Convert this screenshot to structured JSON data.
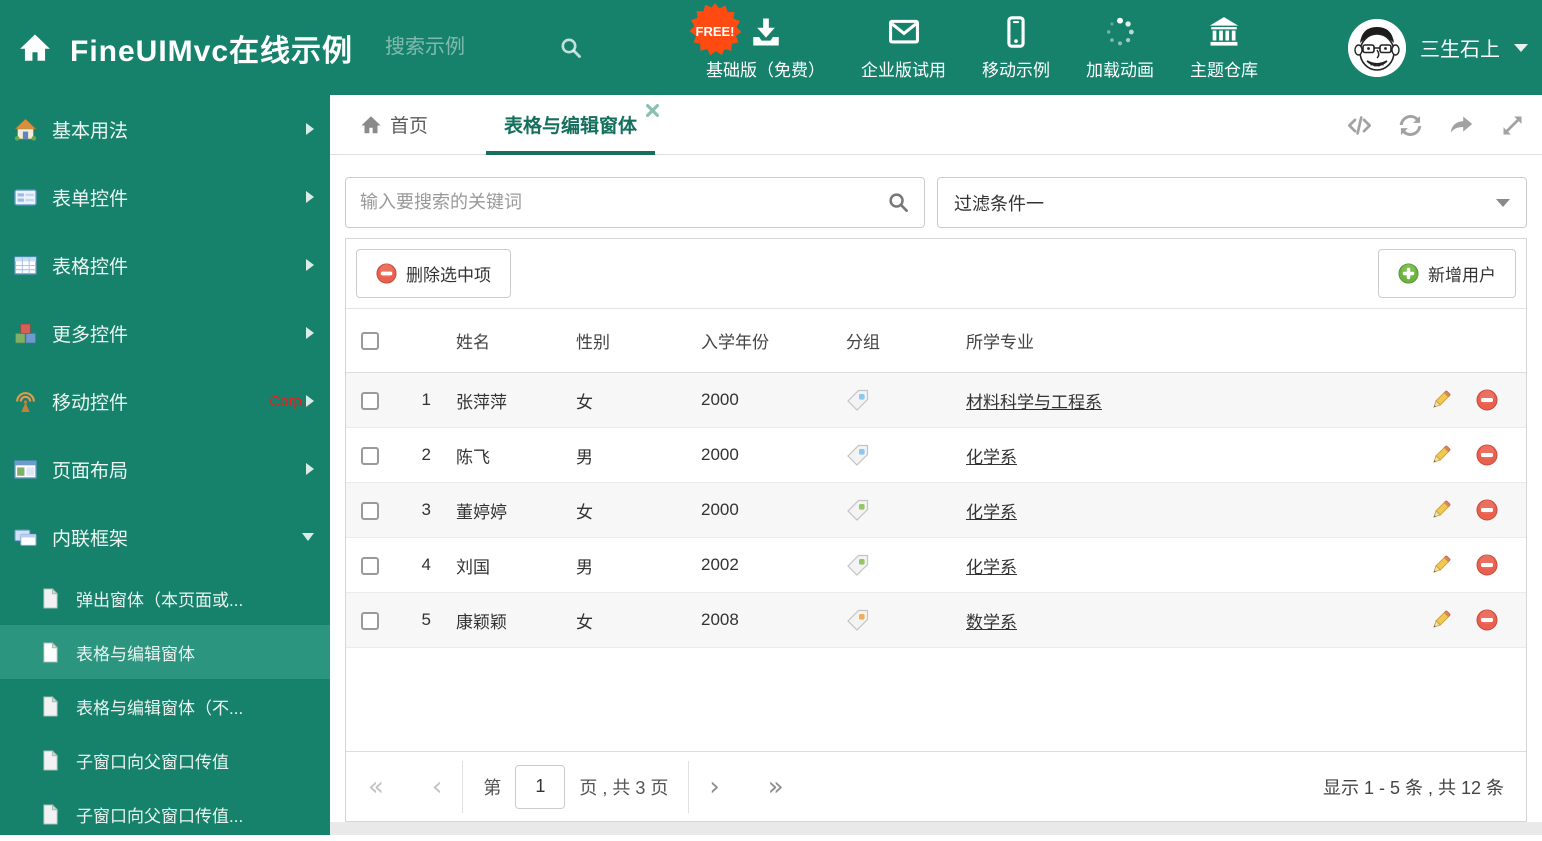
{
  "header": {
    "logo": "FineUIMvc在线示例",
    "search_placeholder": "搜索示例",
    "free_badge": "FREE!",
    "nav": [
      {
        "label": "基础版（免费）"
      },
      {
        "label": "企业版试用"
      },
      {
        "label": "移动示例"
      },
      {
        "label": "加载动画"
      },
      {
        "label": "主题仓库"
      }
    ],
    "username": "三生石上"
  },
  "sidebar": {
    "items": [
      {
        "label": "基本用法"
      },
      {
        "label": "表单控件"
      },
      {
        "label": "表格控件"
      },
      {
        "label": "更多控件"
      },
      {
        "label": "移动控件",
        "badge": "Corp."
      },
      {
        "label": "页面布局"
      },
      {
        "label": "内联框架"
      }
    ],
    "subitems": [
      {
        "label": "弹出窗体（本页面或..."
      },
      {
        "label": "表格与编辑窗体"
      },
      {
        "label": "表格与编辑窗体（不..."
      },
      {
        "label": "子窗口向父窗口传值"
      },
      {
        "label": "子窗口向父窗口传值..."
      }
    ]
  },
  "tabbar": {
    "home_tab": "首页",
    "active_tab": "表格与编辑窗体"
  },
  "filter": {
    "search_placeholder": "输入要搜索的关键词",
    "selected": "过滤条件一"
  },
  "grid": {
    "delete_button": "删除选中项",
    "add_button": "新增用户",
    "columns": {
      "name": "姓名",
      "gender": "性别",
      "year": "入学年份",
      "group": "分组",
      "major": "所学专业"
    },
    "rows": [
      {
        "num": "1",
        "name": "张萍萍",
        "gender": "女",
        "year": "2000",
        "tag_color": "#8BC7F2",
        "major": "材料科学与工程系"
      },
      {
        "num": "2",
        "name": "陈飞",
        "gender": "男",
        "year": "2000",
        "tag_color": "#8BC7F2",
        "major": "化学系"
      },
      {
        "num": "3",
        "name": "董婷婷",
        "gender": "女",
        "year": "2000",
        "tag_color": "#93C763",
        "major": "化学系"
      },
      {
        "num": "4",
        "name": "刘国",
        "gender": "男",
        "year": "2002",
        "tag_color": "#93C763",
        "major": "化学系"
      },
      {
        "num": "5",
        "name": "康颖颖",
        "gender": "女",
        "year": "2008",
        "tag_color": "#F5AB59",
        "major": "数学系"
      }
    ]
  },
  "pagination": {
    "page_prefix": "第",
    "page_value": "1",
    "page_suffix": "页 , 共 3 页",
    "summary": "显示 1 - 5 条 , 共 12 条"
  },
  "colors": {
    "header_teal": "#17826C",
    "selected_teal": "#2B9580",
    "active_tab_teal": "#156F5D",
    "free_badge_orange": "#FF4B12",
    "delete_red": "#E9604F",
    "add_green": "#6DB33F"
  }
}
